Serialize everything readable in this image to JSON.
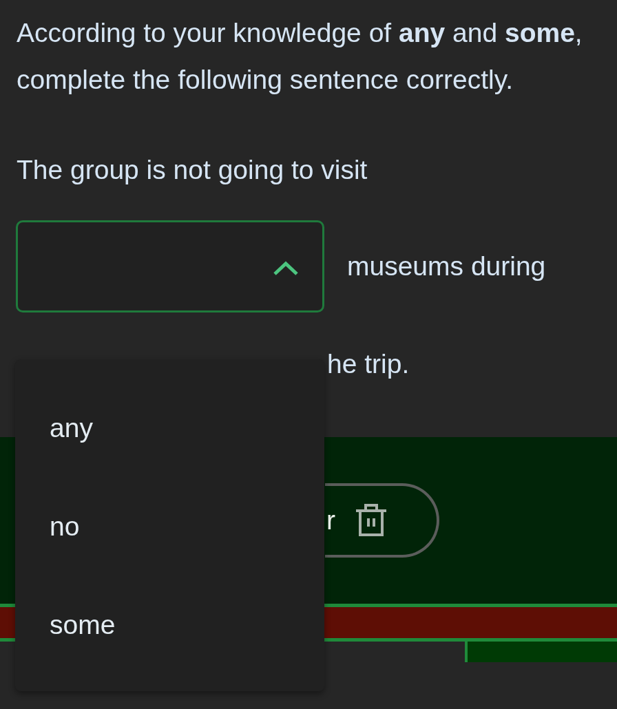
{
  "question": {
    "prompt": "According to your knowledge of **any** and **some**, complete the following sentence correctly.",
    "sentence_start": "The group is not going to visit",
    "select": {
      "expanded": true,
      "options": [
        {
          "label": "any",
          "selected": false
        },
        {
          "label": "no",
          "selected": false
        },
        {
          "label": "some",
          "selected": false
        }
      ]
    },
    "sentence_middle": "museums during",
    "sentence_end": "he trip."
  },
  "action_button": {
    "label": "r"
  }
}
